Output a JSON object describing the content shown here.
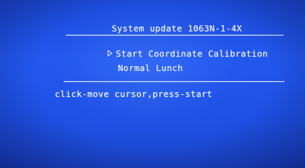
{
  "header": {
    "title": "System update 1063N-1-4X"
  },
  "menu": {
    "items": [
      {
        "label": "Start Coordinate Calibration",
        "selected": true
      },
      {
        "label": "Normal Lunch",
        "selected": false
      }
    ]
  },
  "footer": {
    "hint": "click-move cursor,press-start"
  },
  "colors": {
    "background": "#1f4fe0",
    "text": "#f2f5ff"
  }
}
